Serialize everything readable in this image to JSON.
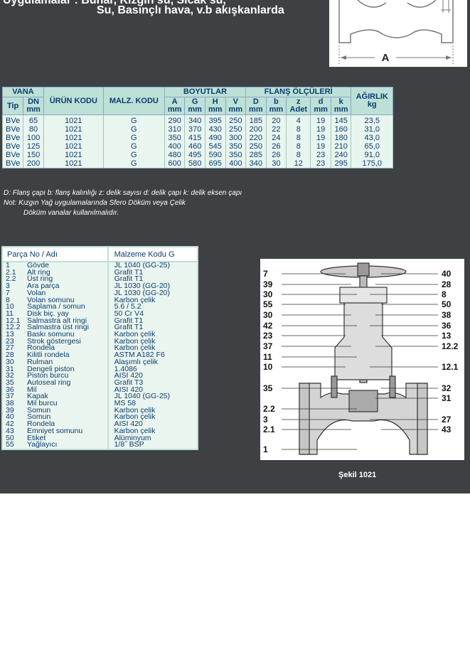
{
  "header": {
    "line1": "Uygulamalar : Buhar, Kızgın su, Sıcak su,",
    "line2": "Su, Basınçlı hava, v.b akışkanlarda"
  },
  "dimension_label": "A",
  "spec_table": {
    "headers": {
      "vana": "VANA",
      "urun_kodu": "ÜRÜN KODU",
      "malz_kodu": "MALZ. KODU",
      "boyutlar": "BOYUTLAR",
      "flans": "FLANŞ ÖLÇÜLERİ",
      "agirlik": "AĞIRLIK",
      "agirlik_unit": "kg",
      "tip": "Tip",
      "dn": "DN",
      "mm": "mm",
      "adet": "Adet",
      "a": "A",
      "g": "G",
      "h": "H",
      "v": "V",
      "d": "D",
      "b": "b",
      "z": "z",
      "dd": "d",
      "k": "k"
    },
    "rows": [
      [
        "BVe",
        "65",
        "1021",
        "G",
        "290",
        "340",
        "395",
        "250",
        "185",
        "20",
        "4",
        "19",
        "145",
        "23,5"
      ],
      [
        "BVe",
        "80",
        "1021",
        "G",
        "310",
        "370",
        "430",
        "250",
        "200",
        "22",
        "8",
        "19",
        "160",
        "31,0"
      ],
      [
        "BVe",
        "100",
        "1021",
        "G",
        "350",
        "415",
        "490",
        "300",
        "220",
        "24",
        "8",
        "19",
        "180",
        "43,0"
      ],
      [
        "BVe",
        "125",
        "1021",
        "G",
        "400",
        "460",
        "545",
        "350",
        "250",
        "26",
        "8",
        "19",
        "210",
        "65,0"
      ],
      [
        "BVe",
        "150",
        "1021",
        "G",
        "480",
        "495",
        "590",
        "350",
        "285",
        "26",
        "8",
        "23",
        "240",
        "91,0"
      ],
      [
        "BVe",
        "200",
        "1021",
        "G",
        "600",
        "580",
        "695",
        "400",
        "340",
        "30",
        "12",
        "23",
        "295",
        "175,0"
      ]
    ]
  },
  "notes": {
    "legend": "D: Flanş çapı  b: flanş kalınlığı  z: delik sayısı  d: delik çapı  k: delik eksen çapı",
    "note1": "Not:  Kızgın Yağ uygulamalarında Sfero Döküm veya Çelik",
    "note2": "Döküm vanalar kullanılmalıdır."
  },
  "parts_table": {
    "header_part": "Parça No / Adı",
    "header_material": "Malzeme Kodu G",
    "rows": [
      [
        "1",
        "Gövde",
        "JL 1040 (GG-25)"
      ],
      [
        "2.1",
        "Alt ring",
        "Grafit T1"
      ],
      [
        "2.2",
        "Üst ring",
        "Grafit T1"
      ],
      [
        "3",
        "Ara parça",
        "JL 1030 (GG-20)"
      ],
      [
        "7",
        "Volan",
        "JL 1030 (GG-20)"
      ],
      [
        "8",
        "Volan somunu",
        "Karbon çelik"
      ],
      [
        "10",
        "Saplama / somun",
        "5.6 / 5.2"
      ],
      [
        "11",
        "Disk biç. yay",
        "50 Cr V4"
      ],
      [
        "12.1",
        "Salmastra alt ringi",
        "Grafit T1"
      ],
      [
        "12.2",
        "Salmastra üst ringi",
        "Grafit T1"
      ],
      [
        "13",
        "Baskı somunu",
        "Karbon çelik"
      ],
      [
        "23",
        "Strok göstergesi",
        "Karbon çelik"
      ],
      [
        "27",
        "Rondela",
        "Karbon çelik"
      ],
      [
        "28",
        "Kilitli rondela",
        "ASTM A182 F6"
      ],
      [
        "30",
        "Rulman",
        "Alaşımlı çelik"
      ],
      [
        "31",
        "Dengeli piston",
        "1.4086"
      ],
      [
        "32",
        "Piston burcu",
        "AISI 420"
      ],
      [
        "35",
        "Autoseal ring",
        "Grafit T3"
      ],
      [
        "36",
        "Mil",
        "AISI 420"
      ],
      [
        "37",
        "Kapak",
        "JL 1040 (GG-25)"
      ],
      [
        "38",
        "Mil burcu",
        "MS 58"
      ],
      [
        "39",
        "Somun",
        "Karbon çelik"
      ],
      [
        "40",
        "Somun",
        "Karbon çelik"
      ],
      [
        "42",
        "Rondela",
        "AISI 420"
      ],
      [
        "43",
        "Emniyet somunu",
        "Karbon çelik"
      ],
      [
        "50",
        "Etiket",
        "Alüminyum"
      ],
      [
        "55",
        "Yağlayıcı",
        "1/8˝ BSP"
      ]
    ]
  },
  "valve_labels": {
    "left": [
      "7",
      "39",
      "30",
      "55",
      "30",
      "42",
      "23",
      "37",
      "11",
      "10",
      "35",
      "2.2",
      "3",
      "2.1",
      "1"
    ],
    "right": [
      "40",
      "28",
      "8",
      "50",
      "38",
      "36",
      "13",
      "12.2",
      "12.1",
      "32",
      "31",
      "27",
      "43"
    ]
  },
  "caption": "Şekil 1021"
}
